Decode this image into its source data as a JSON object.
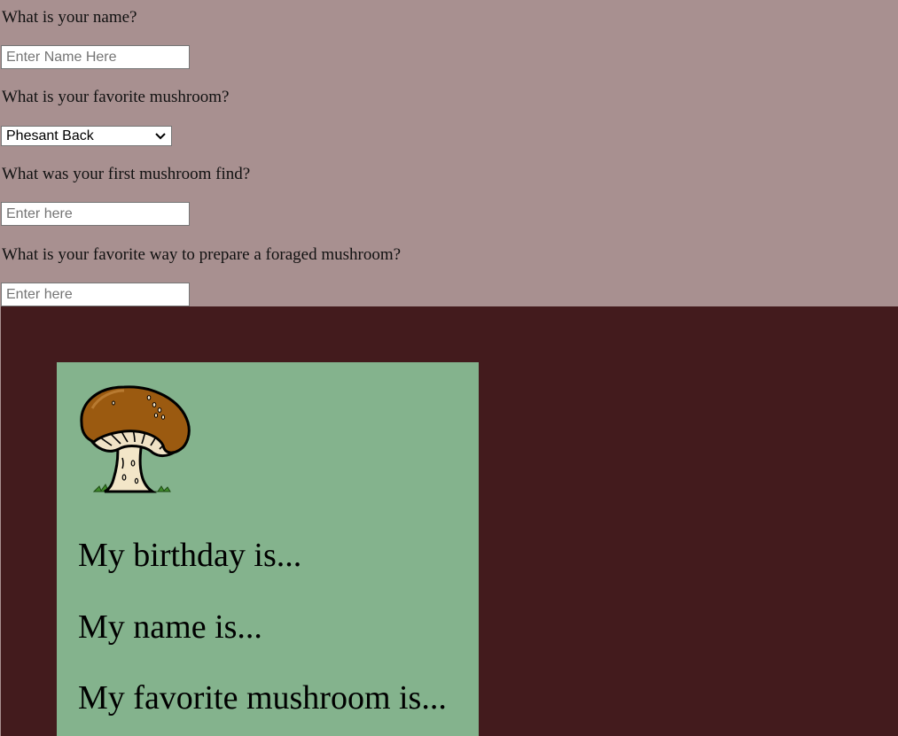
{
  "form": {
    "q_name": "What is your name?",
    "name_placeholder": "Enter Name Here",
    "q_mushroom": "What is your favorite mushroom?",
    "mushroom_selected": "Phesant Back",
    "q_first_find": "What was your first mushroom find?",
    "first_find_placeholder": "Enter here",
    "q_prepare": "What is your favorite way to prepare a foraged mushroom?",
    "prepare_placeholder": "Enter here"
  },
  "card": {
    "image_icon": "mushroom-illustration",
    "line_birthday": "My birthday is...",
    "line_name": "My name is...",
    "line_mushroom": "My favorite mushroom is..."
  },
  "colors": {
    "page_background": "#a89090",
    "lower_background": "#431b1d",
    "card_background": "#84b38d"
  }
}
